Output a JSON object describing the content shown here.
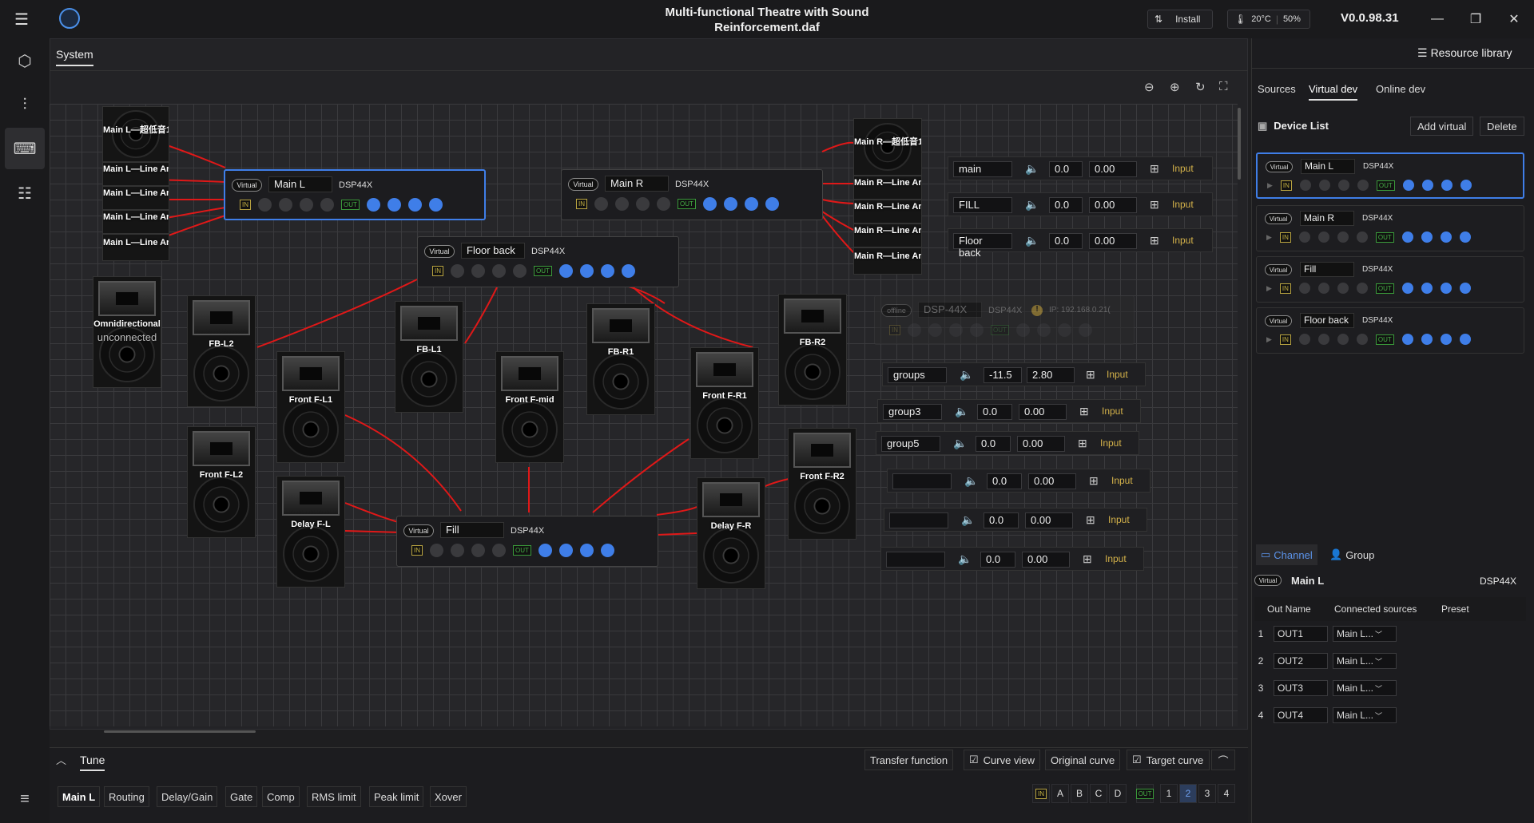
{
  "app": {
    "title_line1": "Multi-functional Theatre with Sound",
    "title_line2": "Reinforcement.daf",
    "install_label": "Install",
    "temperature": "20°C",
    "load": "50%",
    "version": "V0.0.98.31"
  },
  "tabs": {
    "system": "System"
  },
  "speakers": {
    "main_l_sub": "Main L—超低音1",
    "main_l_line1": "Main L—Line Ar",
    "main_l_line2": "Main L—Line Ar",
    "main_l_line3": "Main L—Line Ar",
    "main_l_line4": "Main L—Line Ar",
    "main_r_sub": "Main R—超低音1",
    "main_r_line1": "Main R—Line Ar",
    "main_r_line2": "Main R—Line Ar",
    "main_r_line3": "Main R—Line Ar",
    "main_r_line4": "Main R—Line Ar",
    "omni": "Omnidirectional",
    "omni_status": "unconnected",
    "fb_l2": "FB-L2",
    "fb_l1": "FB-L1",
    "fb_r1": "FB-R1",
    "fb_r2": "FB-R2",
    "front_fl1": "Front F-L1",
    "front_fmid": "Front F-mid",
    "front_fr1": "Front F-R1",
    "front_fl2": "Front F-L2",
    "front_fr2": "Front F-R2",
    "delay_fl": "Delay F-L",
    "delay_fr": "Delay F-R"
  },
  "dsp_nodes": {
    "main_l": {
      "badge": "Virtual",
      "name": "Main L",
      "model": "DSP44X",
      "in": "IN",
      "out": "OUT"
    },
    "main_r": {
      "badge": "Virtual",
      "name": "Main R",
      "model": "DSP44X",
      "in": "IN",
      "out": "OUT"
    },
    "floor_back": {
      "badge": "Virtual",
      "name": "Floor back",
      "model": "DSP44X",
      "in": "IN",
      "out": "OUT"
    },
    "fill": {
      "badge": "Virtual",
      "name": "Fill",
      "model": "DSP44X",
      "in": "IN",
      "out": "OUT"
    },
    "offline": {
      "badge": "offline",
      "name": "DSP-44X",
      "model": "DSP44X",
      "ip": "IP: 192.168.0.21(",
      "in": "IN",
      "out": "OUT"
    }
  },
  "groups": [
    {
      "name": "main",
      "gain": "0.0",
      "delay": "0.00",
      "input": "Input"
    },
    {
      "name": "FILL",
      "gain": "0.0",
      "delay": "0.00",
      "input": "Input"
    },
    {
      "name": "Floor back",
      "gain": "0.0",
      "delay": "0.00",
      "input": "Input"
    },
    {
      "name": "groups",
      "gain": "-11.5",
      "delay": "2.80",
      "input": "Input"
    },
    {
      "name": "group3",
      "gain": "0.0",
      "delay": "0.00",
      "input": "Input"
    },
    {
      "name": "group5",
      "gain": "0.0",
      "delay": "0.00",
      "input": "Input"
    },
    {
      "name": "",
      "gain": "0.0",
      "delay": "0.00",
      "input": "Input"
    },
    {
      "name": "",
      "gain": "0.0",
      "delay": "0.00",
      "input": "Input"
    },
    {
      "name": "",
      "gain": "0.0",
      "delay": "0.00",
      "input": "Input"
    }
  ],
  "right_panel": {
    "header": "Resource library",
    "tabs": [
      "Sources",
      "Virtual dev",
      "Online dev"
    ],
    "device_list_label": "Device List",
    "add_virtual": "Add virtual",
    "delete": "Delete",
    "devices": [
      {
        "badge": "Virtual",
        "name": "Main L",
        "model": "DSP44X",
        "in": "IN",
        "out": "OUT"
      },
      {
        "badge": "Virtual",
        "name": "Main R",
        "model": "DSP44X",
        "in": "IN",
        "out": "OUT"
      },
      {
        "badge": "Virtual",
        "name": "Fill",
        "model": "DSP44X",
        "in": "IN",
        "out": "OUT"
      },
      {
        "badge": "Virtual",
        "name": "Floor back",
        "model": "DSP44X",
        "in": "IN",
        "out": "OUT"
      }
    ],
    "channel_tab": "Channel",
    "group_tab": "Group",
    "selected_badge": "Virtual",
    "selected_name": "Main L",
    "selected_model": "DSP44X",
    "col_out_name": "Out Name",
    "col_connected": "Connected sources",
    "col_preset": "Preset",
    "outputs": [
      {
        "num": "1",
        "name": "OUT1",
        "source": "Main L..."
      },
      {
        "num": "2",
        "name": "OUT2",
        "source": "Main L..."
      },
      {
        "num": "3",
        "name": "OUT3",
        "source": "Main L..."
      },
      {
        "num": "4",
        "name": "OUT4",
        "source": "Main L..."
      }
    ]
  },
  "bottom": {
    "tune_label": "Tune",
    "transfer_function": "Transfer function",
    "curve_view": "Curve view",
    "original_curve": "Original curve",
    "target_curve": "Target curve",
    "tabs": [
      "Main L",
      "Routing",
      "Delay/Gain",
      "Gate",
      "Comp",
      "RMS limit",
      "Peak limit",
      "Xover"
    ],
    "in_label": "IN",
    "in_channels": [
      "A",
      "B",
      "C",
      "D"
    ],
    "out_label": "OUT",
    "out_channels": [
      "1",
      "2",
      "3",
      "4"
    ]
  }
}
